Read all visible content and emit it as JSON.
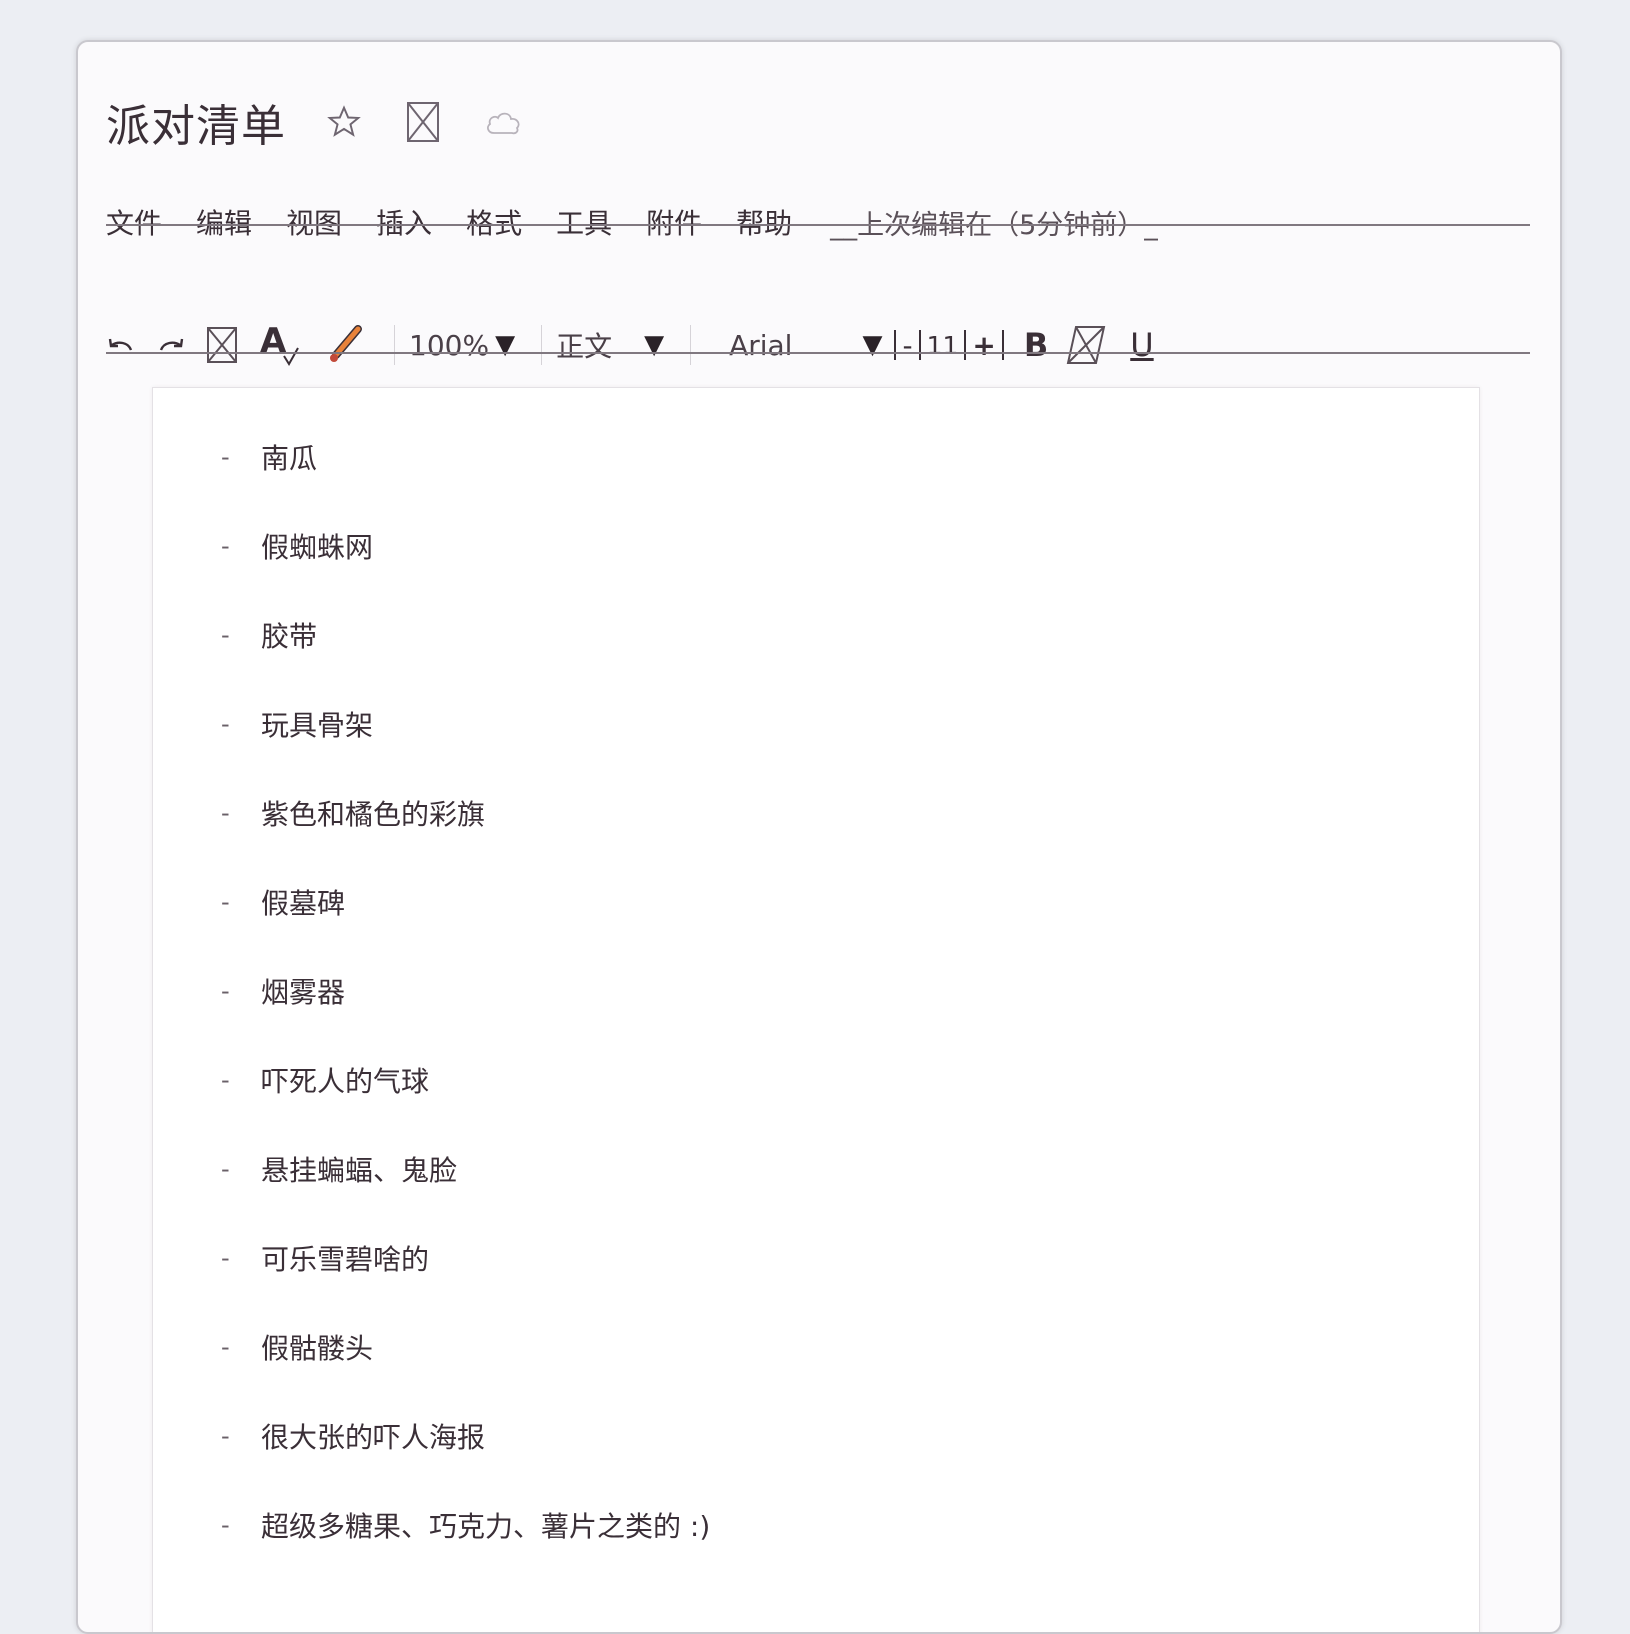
{
  "document": {
    "title": "派对清单",
    "last_edit": "__上次编辑在（5分钟前）_"
  },
  "title_icons": {
    "star": "star-icon",
    "folder": "move-to-folder-icon",
    "cloud": "cloud-saved-icon"
  },
  "menu": {
    "items": [
      "文件",
      "编辑",
      "视图",
      "插入",
      "格式",
      "工具",
      "附件",
      "帮助"
    ]
  },
  "toolbar": {
    "zoom": "100%",
    "style": "正文",
    "font": "Arial",
    "font_size": "11",
    "decrease": "-",
    "increase": "+",
    "bold": "B",
    "underline": "U"
  },
  "list_marker": "-",
  "content": {
    "items": [
      "南瓜",
      "假蜘蛛网",
      "胶带",
      "玩具骨架",
      "紫色和橘色的彩旗",
      "假墓碑",
      "烟雾器",
      "吓死人的气球",
      "悬挂蝙蝠、鬼脸",
      "可乐雪碧啥的",
      "假骷髅头",
      "很大张的吓人海报",
      "超级多糖果、巧克力、薯片之类的 :)"
    ]
  },
  "colors": {
    "text": "#3a2f37",
    "pencil": "#e8823a",
    "window_bg": "#fbfafc"
  }
}
